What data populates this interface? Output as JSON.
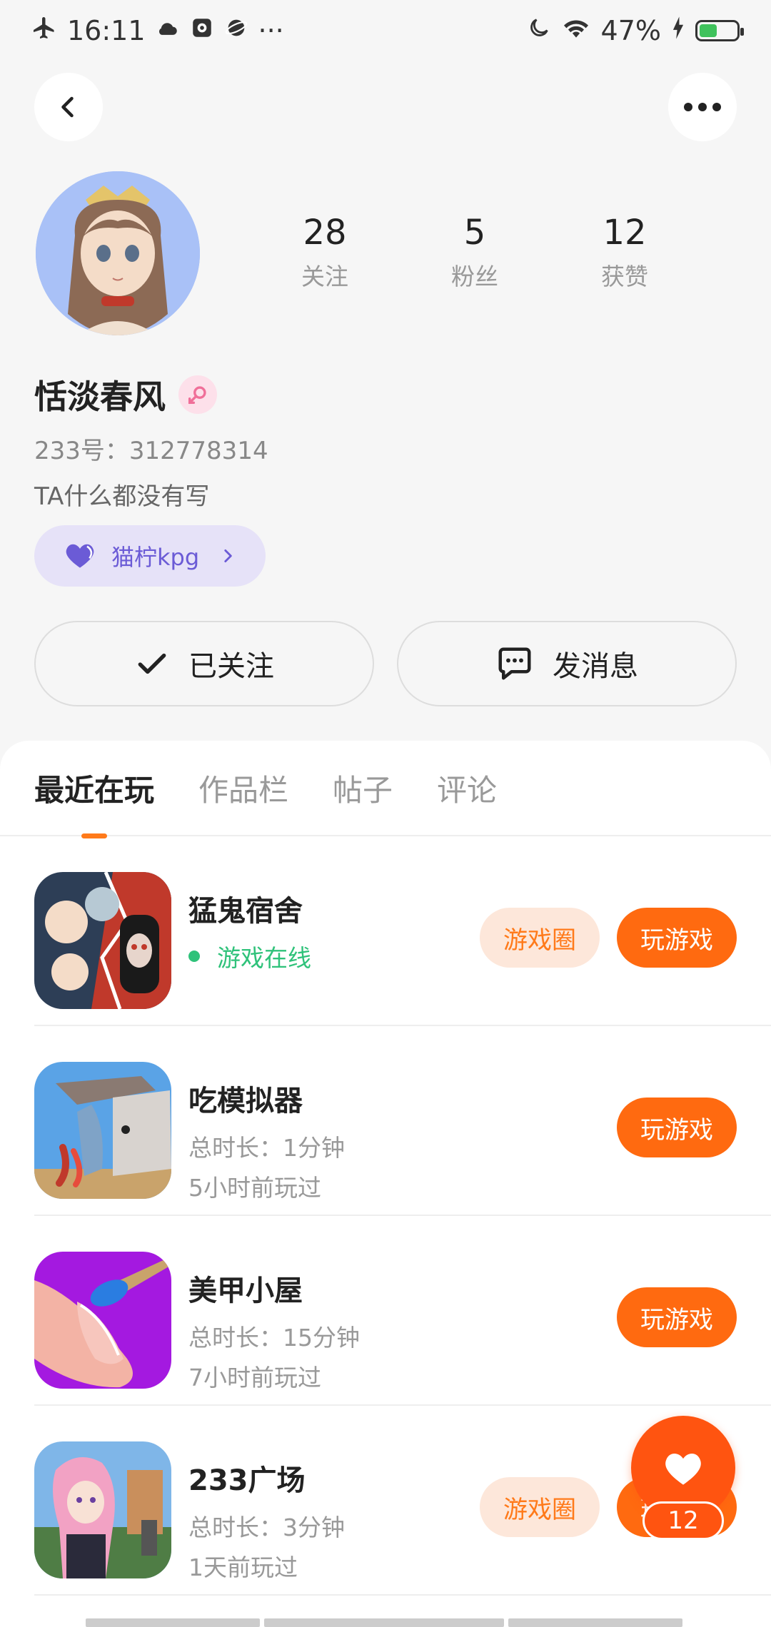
{
  "status_bar": {
    "time": "16:11",
    "battery": "47%",
    "battery_level": 0.47,
    "more": "···"
  },
  "profile": {
    "stats": [
      {
        "num": "28",
        "label": "关注"
      },
      {
        "num": "5",
        "label": "粉丝"
      },
      {
        "num": "12",
        "label": "获赞"
      }
    ],
    "name": "恬淡春风",
    "uid": "233号：312778314",
    "bio": "TA什么都没有写",
    "group_tag": "猫柠kpg"
  },
  "actions": {
    "follow": "已关注",
    "message": "发消息"
  },
  "tabs": [
    "最近在玩",
    "作品栏",
    "帖子",
    "评论"
  ],
  "games": [
    {
      "title": "猛鬼宿舍",
      "online": "游戏在线",
      "circle_label": "游戏圈",
      "play_label": "玩游戏"
    },
    {
      "title": "吃模拟器",
      "duration": "总时长：1分钟",
      "last_played": "5小时前玩过",
      "play_label": "玩游戏"
    },
    {
      "title": "美甲小屋",
      "duration": "总时长：15分钟",
      "last_played": "7小时前玩过",
      "play_label": "玩游戏"
    },
    {
      "title": "233广场",
      "duration": "总时长：3分钟",
      "last_played": "1天前玩过",
      "circle_label": "游戏圈",
      "play_label": "玩游戏"
    }
  ],
  "floating_like": {
    "count": "12"
  },
  "colors": {
    "accent": "#ff6a10",
    "online": "#2fc27a",
    "group_tag": "#6b5bd6"
  }
}
